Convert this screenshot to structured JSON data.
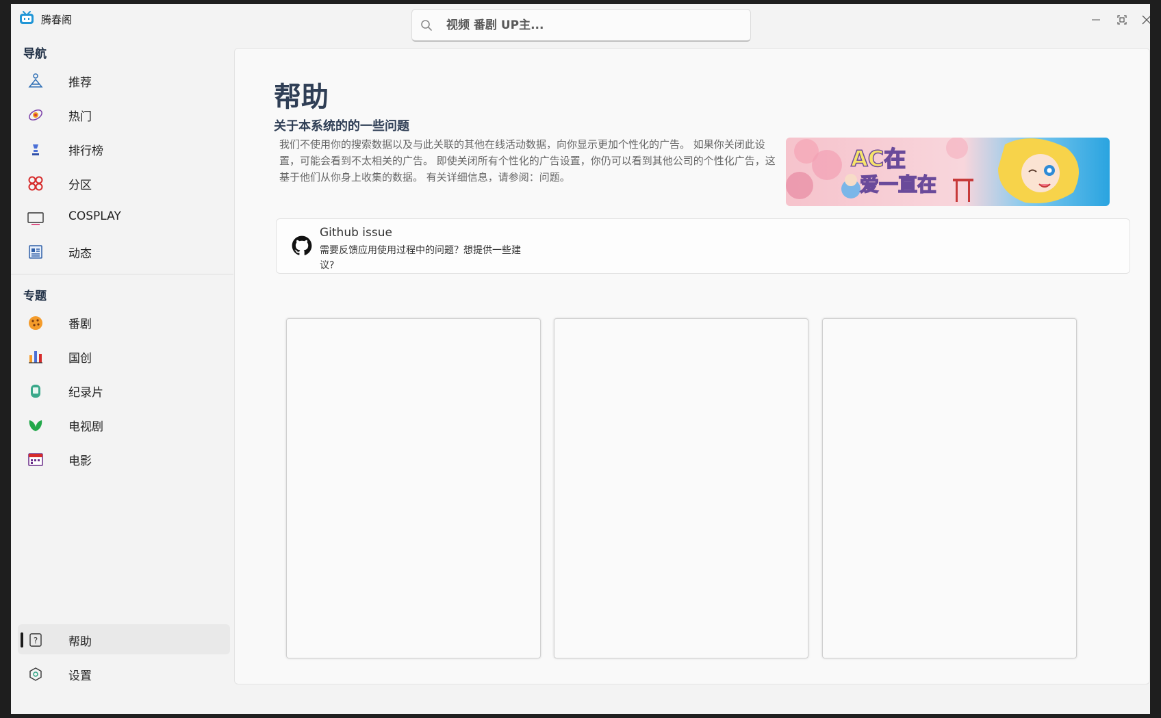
{
  "app": {
    "title": "腾春阁"
  },
  "search": {
    "placeholder": "视频 番剧 UP主..."
  },
  "sidebar": {
    "nav_title": "导航",
    "nav_items": [
      {
        "label": "推荐",
        "icon": "recommend-icon"
      },
      {
        "label": "热门",
        "icon": "hot-icon"
      },
      {
        "label": "排行榜",
        "icon": "ranking-icon"
      },
      {
        "label": "分区",
        "icon": "category-icon"
      },
      {
        "label": "COSPLAY",
        "icon": "cosplay-icon"
      },
      {
        "label": "动态",
        "icon": "feed-icon"
      }
    ],
    "topic_title": "专题",
    "topic_items": [
      {
        "label": "番剧",
        "icon": "anime-icon"
      },
      {
        "label": "国创",
        "icon": "guochuang-icon"
      },
      {
        "label": "纪录片",
        "icon": "documentary-icon"
      },
      {
        "label": "电视剧",
        "icon": "tv-series-icon"
      },
      {
        "label": "电影",
        "icon": "movie-icon"
      }
    ],
    "footer_items": [
      {
        "label": "帮助",
        "icon": "help-icon",
        "active": true
      },
      {
        "label": "设置",
        "icon": "settings-icon",
        "active": false
      }
    ]
  },
  "main": {
    "title": "帮助",
    "subtitle": "关于本系统的的一些问题",
    "description": "我们不使用你的搜索数据以及与此关联的其他在线活动数据，向你显示更加个性化的广告。 如果你关闭此设置，可能会看到不太相关的广告。 即使关闭所有个性化的广告设置，你仍可以看到其他公司的个性化广告，这基于他们从你身上收集的数据。 有关详细信息，请参阅：问题。",
    "banner_text": "AC在 爱一直在",
    "issue": {
      "title": "Github issue",
      "description": "需要反馈应用使用过程中的问题？想提供一些建议?"
    }
  },
  "colors": {
    "brand": "#2196d6",
    "heading": "#2f3e55"
  }
}
